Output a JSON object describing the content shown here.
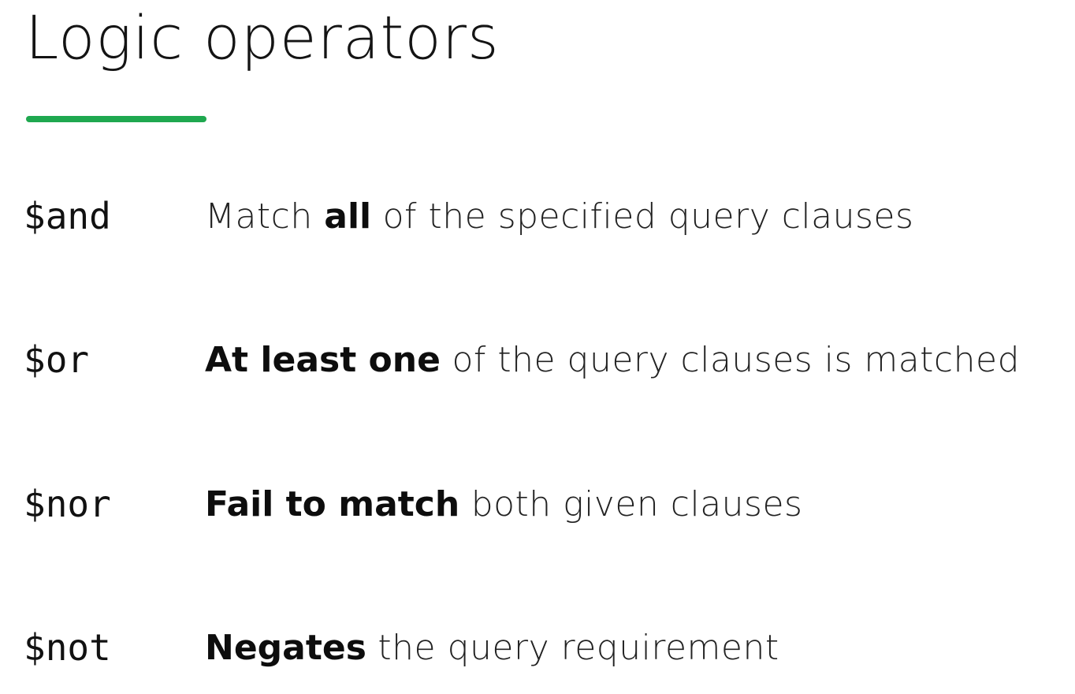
{
  "slide": {
    "title": "Logic operators",
    "accent_color": "#1fa84f"
  },
  "operators": [
    {
      "op": "$and",
      "pre": "Match ",
      "bold": "all",
      "post": " of the specified query clauses"
    },
    {
      "op": "$or",
      "pre": "",
      "bold": "At least one",
      "post": " of the query clauses is matched"
    },
    {
      "op": "$nor",
      "pre": "",
      "bold": "Fail to match",
      "post": " both given clauses"
    },
    {
      "op": "$not",
      "pre": "",
      "bold": "Negates",
      "post": " the query requirement"
    }
  ]
}
